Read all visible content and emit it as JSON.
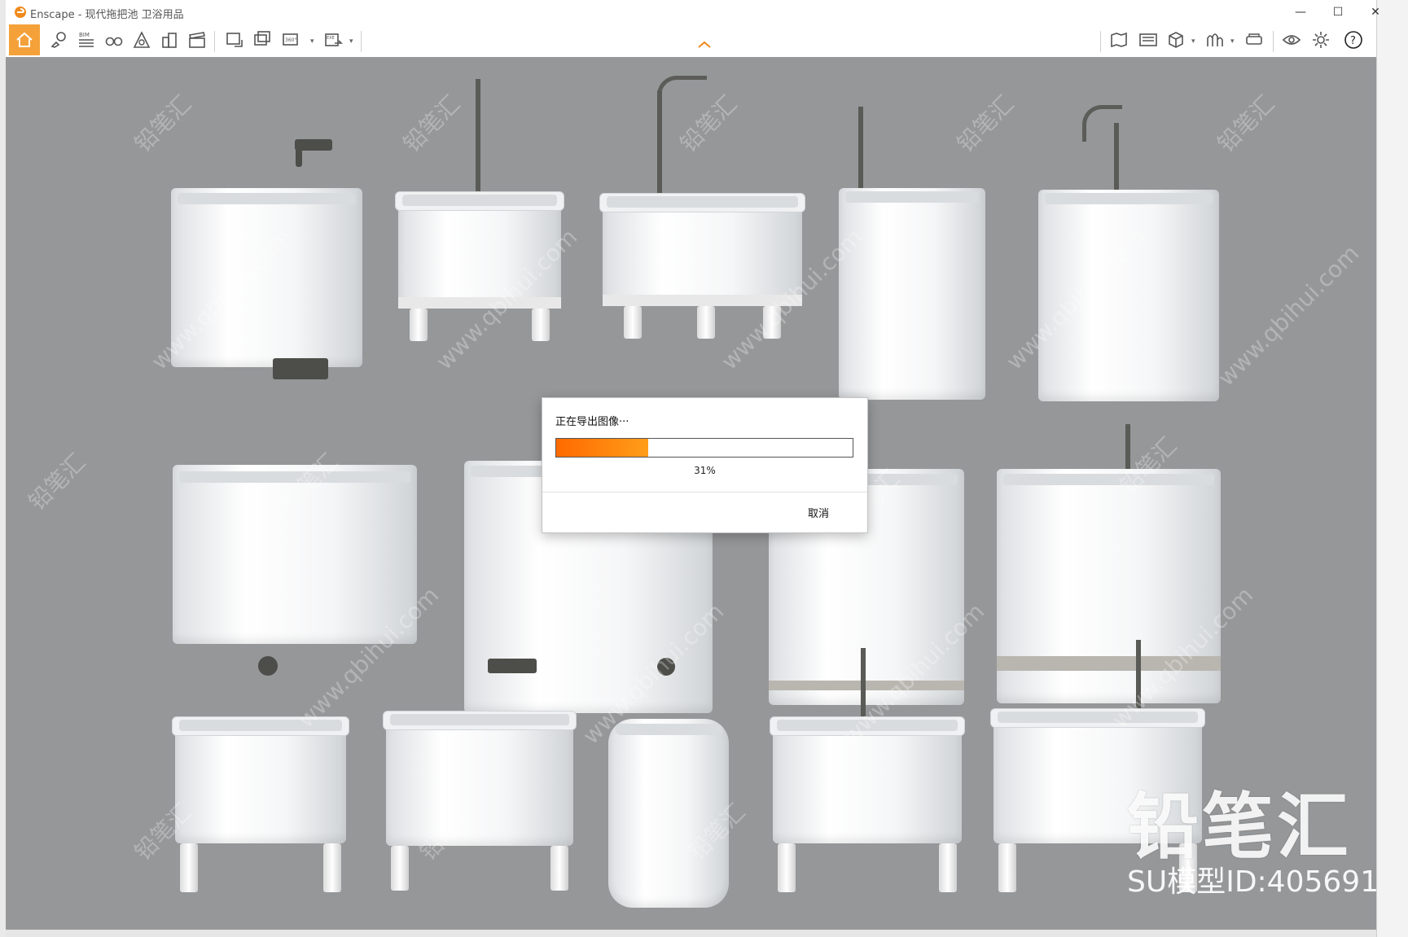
{
  "window": {
    "title": "Enscape - 现代拖把池 卫浴用品",
    "controls": {
      "minimize": "—",
      "maximize": "☐",
      "close": "✕"
    }
  },
  "toolbar": {
    "items": [
      {
        "name": "home-icon",
        "label": "Home"
      },
      {
        "name": "navigation-icon",
        "label": "Navigation"
      },
      {
        "name": "bim-icon",
        "label": "BIM"
      },
      {
        "name": "binoculars-icon",
        "label": "Views"
      },
      {
        "name": "atmosphere-icon",
        "label": "Atmosphere"
      },
      {
        "name": "buildings-icon",
        "label": "Context"
      },
      {
        "name": "clapper-icon",
        "label": "Video"
      },
      {
        "name": "screenshot-icon",
        "label": "Screenshot"
      },
      {
        "name": "batch-render-icon",
        "label": "Batch"
      },
      {
        "name": "panorama-360-icon",
        "label": "360"
      },
      {
        "name": "exe-export-icon",
        "label": "EXE"
      },
      {
        "name": "map-icon",
        "label": "Map"
      },
      {
        "name": "gallery-icon",
        "label": "Gallery"
      },
      {
        "name": "asset-cube-icon",
        "label": "Assets"
      },
      {
        "name": "materials-icon",
        "label": "Materials"
      },
      {
        "name": "vr-headset-icon",
        "label": "VR"
      },
      {
        "name": "visual-settings-icon",
        "label": "Visual"
      },
      {
        "name": "settings-gear-icon",
        "label": "Settings"
      },
      {
        "name": "help-icon",
        "label": "?"
      }
    ],
    "bim_label": "BIM",
    "pano_label": "360°",
    "exe_label": "EXE",
    "help_label": "?"
  },
  "watermark": {
    "brand": "铅笔汇",
    "model_id": "SU模型ID:405691",
    "site": "www.qbihui.com"
  },
  "dialog": {
    "title": "正在导出图像···",
    "progress_percent": 31,
    "progress_label": "31%",
    "cancel_label": "取消"
  },
  "colors": {
    "accent": "#f4a13a",
    "viewport_bg": "#959799",
    "progress_start": "#ff6a00",
    "progress_end": "#ff9d1a"
  }
}
